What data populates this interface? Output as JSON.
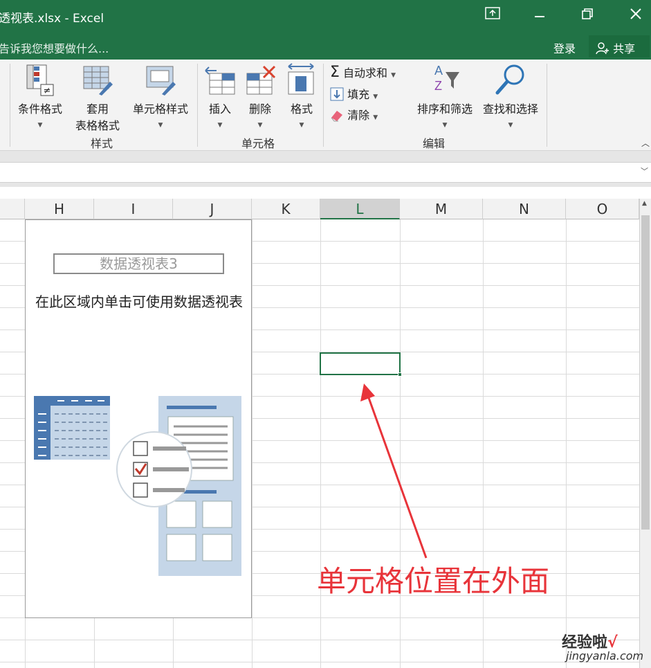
{
  "window": {
    "title": "透视表.xlsx - Excel",
    "controls": [
      "ribbon-display-icon",
      "minimize-icon",
      "restore-icon",
      "close-icon"
    ]
  },
  "tellme": {
    "placeholder": "告诉我您想要做什么...",
    "login": "登录",
    "share": "共享"
  },
  "ribbon": {
    "styles": {
      "conditional_format": "条件格式",
      "table_format_line1": "套用",
      "table_format_line2": "表格格式",
      "cell_styles": "单元格样式",
      "group": "样式"
    },
    "cells": {
      "insert": "插入",
      "delete": "删除",
      "format": "格式",
      "group": "单元格"
    },
    "editing": {
      "autosum": "自动求和",
      "fill": "填充",
      "clear": "清除",
      "sort_filter": "排序和筛选",
      "find_select": "查找和选择",
      "group": "编辑"
    }
  },
  "columns": [
    "H",
    "I",
    "J",
    "K",
    "L",
    "M",
    "N",
    "O"
  ],
  "selected_column": "L",
  "pivot": {
    "name": "数据透视表3",
    "message": "在此区域内单击可使用数据透视表"
  },
  "annotation": "单元格位置在外面",
  "watermark": {
    "brand": "经验啦",
    "url": "jingyanla.com",
    "check_color": "#e8343a"
  },
  "colors": {
    "excel_green": "#217346",
    "annotation_red": "#e8343a",
    "pivot_blue": "#4a78b0",
    "pivot_light": "#c5d6e8"
  }
}
